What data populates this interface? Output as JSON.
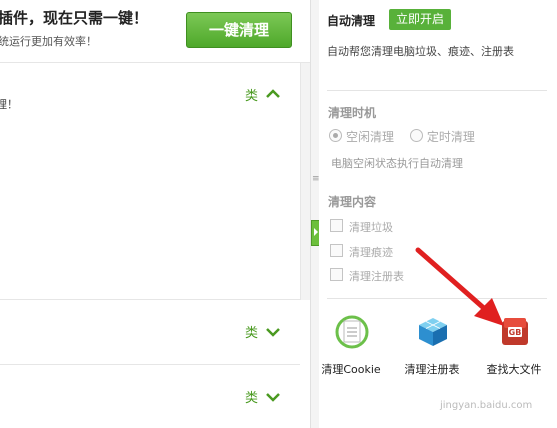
{
  "banner": {
    "title": "插件，现在只需一键！",
    "subtitle": "统运行更加有效率！",
    "clean_button": "一键清理"
  },
  "left_sections": [
    {
      "text": "理！",
      "type_label": "类"
    },
    {
      "text": "",
      "type_label": "类"
    },
    {
      "text": "",
      "type_label": "类"
    }
  ],
  "auto_clean": {
    "title": "自动清理",
    "open_button": "立即开启",
    "description": "自动帮您清理电脑垃圾、痕迹、注册表"
  },
  "timing": {
    "title": "清理时机",
    "options": [
      "空闲清理",
      "定时清理"
    ],
    "selected": "空闲清理",
    "description": "电脑空闲状态执行自动清理"
  },
  "content": {
    "title": "清理内容",
    "items": [
      "清理垃圾",
      "清理痕迹",
      "清理注册表"
    ]
  },
  "tools": [
    {
      "label": "清理Cookie",
      "icon": "cookie-icon"
    },
    {
      "label": "清理注册表",
      "icon": "registry-cube-icon"
    },
    {
      "label": "查找大文件",
      "icon": "big-file-gb-icon"
    }
  ],
  "watermark": "jingyan.baidu.com",
  "colors": {
    "accent_green": "#58b13a",
    "arrow_red": "#e02020",
    "chevron_green": "#4a9a20"
  }
}
